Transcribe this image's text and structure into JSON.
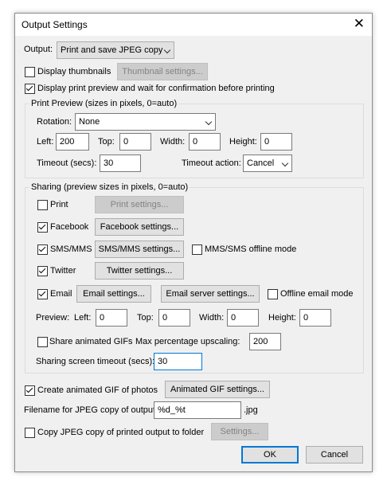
{
  "window": {
    "title": "Output Settings"
  },
  "output": {
    "label": "Output:",
    "selected": "Print and save JPEG copy"
  },
  "thumbnails": {
    "label": "Display thumbnails",
    "checked": false,
    "button": "Thumbnail settings..."
  },
  "preview_confirm": {
    "label": "Display print preview and wait for confirmation before printing",
    "checked": true
  },
  "print_preview": {
    "group_label": "Print Preview (sizes in pixels, 0=auto)",
    "rotation_label": "Rotation:",
    "rotation_value": "None",
    "left_label": "Left:",
    "left_value": "200",
    "top_label": "Top:",
    "top_value": "0",
    "width_label": "Width:",
    "width_value": "0",
    "height_label": "Height:",
    "height_value": "0",
    "timeout_label": "Timeout (secs):",
    "timeout_value": "30",
    "timeout_action_label": "Timeout action:",
    "timeout_action_value": "Cancel"
  },
  "sharing": {
    "group_label": "Sharing (preview sizes in pixels, 0=auto)",
    "print_label": "Print",
    "print_checked": false,
    "print_button": "Print settings...",
    "facebook_label": "Facebook",
    "facebook_checked": true,
    "facebook_button": "Facebook settings...",
    "sms_label": "SMS/MMS",
    "sms_checked": true,
    "sms_button": "SMS/MMS settings...",
    "sms_offline_label": "MMS/SMS offline mode",
    "sms_offline_checked": false,
    "twitter_label": "Twitter",
    "twitter_checked": true,
    "twitter_button": "Twitter settings...",
    "email_label": "Email",
    "email_checked": true,
    "email_button": "Email settings...",
    "email_server_button": "Email server settings...",
    "offline_email_label": "Offline email mode",
    "offline_email_checked": false,
    "preview_label": "Preview:",
    "left_label": "Left:",
    "left_value": "0",
    "top_label": "Top:",
    "top_value": "0",
    "width_label": "Width:",
    "width_value": "0",
    "height_label": "Height:",
    "height_value": "0",
    "animated_label": "Share animated GIFs",
    "animated_checked": false,
    "upscaling_label": "Max percentage upscaling:",
    "upscaling_value": "200",
    "timeout_label": "Sharing screen timeout (secs):",
    "timeout_value": "30"
  },
  "gif": {
    "label": "Create animated GIF of photos",
    "checked": true,
    "button": "Animated GIF settings..."
  },
  "filename": {
    "label": "Filename for JPEG copy of output:",
    "value": "%d_%t",
    "ext": ".jpg"
  },
  "copy_folder": {
    "label": "Copy JPEG copy of printed output to folder",
    "checked": false,
    "button": "Settings..."
  },
  "footer": {
    "ok": "OK",
    "cancel": "Cancel"
  },
  "icons": {
    "close": "close-icon",
    "dropdown": "chevron-down-icon",
    "check": "checkmark-icon"
  },
  "colors": {
    "accent": "#0078d7",
    "window_bg": "#f0f0f0",
    "button_bg": "#e1e1e1"
  }
}
